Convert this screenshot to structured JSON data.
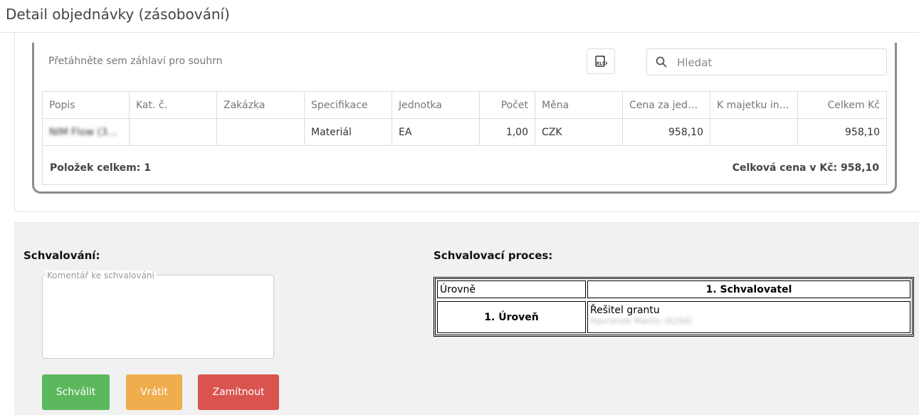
{
  "page": {
    "title": "Detail objednávky (zásobování)"
  },
  "grid": {
    "group_hint": "Přetáhněte sem záhlaví pro souhrn",
    "export_icon": "xlsx-export-icon",
    "search_placeholder": "Hledat",
    "columns": [
      "Popis",
      "Kat. č.",
      "Zakázka",
      "Specifikace",
      "Jednotka",
      "Počet",
      "Měna",
      "Cena za jedn...",
      "K majetku inv...",
      "Celkem Kč"
    ],
    "rows": [
      {
        "popis": "NIM Flow (3R)...",
        "kat": "",
        "zakazka": "",
        "specifikace": "Materiál",
        "jednotka": "EA",
        "pocet": "1,00",
        "mena": "CZK",
        "cena": "958,10",
        "majetek": "",
        "celkem": "958,10"
      }
    ],
    "summary_left": "Položek celkem: 1",
    "summary_right": "Celková cena v Kč: 958,10"
  },
  "approval": {
    "title": "Schvalování:",
    "comment_label": "Komentář ke schvalování",
    "buttons": {
      "approve": "Schválit",
      "return": "Vrátit",
      "reject": "Zamítnout"
    },
    "colors": {
      "approve": "#5cb85c",
      "return": "#f0ad4e",
      "reject": "#d9534f"
    }
  },
  "process": {
    "title": "Schvalovací proces:",
    "header_levels": "Úrovně",
    "header_approver": "1. Schvalovatel",
    "level": "1. Úroveň",
    "role": "Řešitel grantu",
    "person": "Havránek Martin (6294)"
  }
}
